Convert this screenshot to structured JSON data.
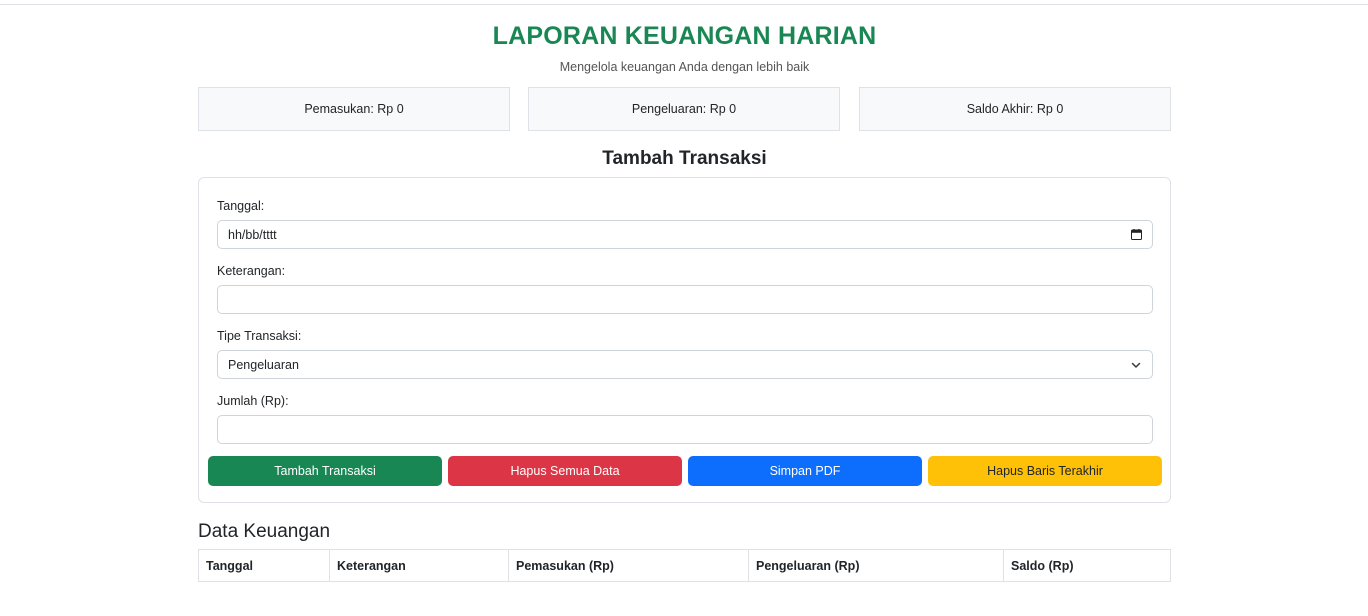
{
  "header": {
    "title": "LAPORAN KEUANGAN HARIAN",
    "subtitle": "Mengelola keuangan Anda dengan lebih baik"
  },
  "summary": {
    "income_label": "Pemasukan: Rp 0",
    "expense_label": "Pengeluaran: Rp 0",
    "balance_label": "Saldo Akhir: Rp 0"
  },
  "form": {
    "title": "Tambah Transaksi",
    "date_label": "Tanggal:",
    "date_placeholder": "hh/bb/tttt",
    "description_label": "Keterangan:",
    "description_value": "",
    "type_label": "Tipe Transaksi:",
    "type_selected": "Pengeluaran",
    "amount_label": "Jumlah (Rp):",
    "amount_value": ""
  },
  "buttons": {
    "add": "Tambah Transaksi",
    "delete_all": "Hapus Semua Data",
    "save_pdf": "Simpan PDF",
    "delete_last": "Hapus Baris Terakhir"
  },
  "table": {
    "title": "Data Keuangan",
    "columns": [
      "Tanggal",
      "Keterangan",
      "Pemasukan (Rp)",
      "Pengeluaran (Rp)",
      "Saldo (Rp)"
    ]
  },
  "colors": {
    "primary_green": "#198754",
    "danger_red": "#dc3545",
    "primary_blue": "#0d6efd",
    "warning_yellow": "#ffc107"
  },
  "icons": {
    "date": "calendar-icon",
    "select": "chevron-down-icon"
  }
}
